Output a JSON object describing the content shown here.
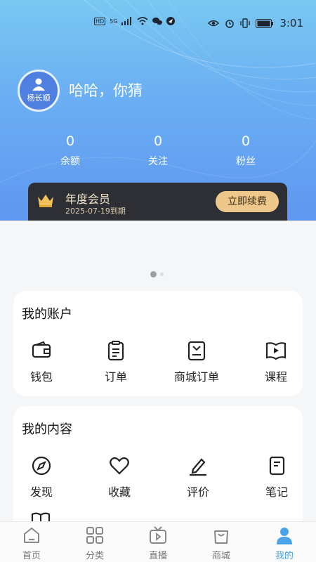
{
  "status_bar": {
    "time": "3:01",
    "signal_label": "HD",
    "network": "5G"
  },
  "profile": {
    "avatar_text": "杨长顺",
    "username": "哈哈，你猜"
  },
  "stats": [
    {
      "value": "0",
      "label": "余额"
    },
    {
      "value": "0",
      "label": "关注"
    },
    {
      "value": "0",
      "label": "粉丝"
    }
  ],
  "membership": {
    "title": "年度会员",
    "expiry": "2025-07-19到期",
    "renew_label": "立即续费"
  },
  "account": {
    "title": "我的账户",
    "items": [
      {
        "label": "钱包",
        "icon": "wallet-icon"
      },
      {
        "label": "订单",
        "icon": "order-icon"
      },
      {
        "label": "商城订单",
        "icon": "mall-order-icon"
      },
      {
        "label": "课程",
        "icon": "course-icon"
      }
    ]
  },
  "content": {
    "title": "我的内容",
    "items": [
      {
        "label": "发现",
        "icon": "compass-icon"
      },
      {
        "label": "收藏",
        "icon": "heart-icon"
      },
      {
        "label": "评价",
        "icon": "pen-icon"
      },
      {
        "label": "笔记",
        "icon": "notebook-icon"
      },
      {
        "label": "",
        "icon": "book-icon"
      }
    ]
  },
  "tabbar": [
    {
      "label": "首页",
      "icon": "home-icon"
    },
    {
      "label": "分类",
      "icon": "category-icon"
    },
    {
      "label": "直播",
      "icon": "live-tv-icon"
    },
    {
      "label": "商城",
      "icon": "shop-bag-icon"
    },
    {
      "label": "我的",
      "icon": "profile-icon",
      "active": true
    }
  ],
  "colors": {
    "accent": "#4aa3e8",
    "header_top": "#78c8f2",
    "header_bottom": "#5f97f0",
    "gold": "#eec78a",
    "member_bg": "#2d2f35"
  }
}
